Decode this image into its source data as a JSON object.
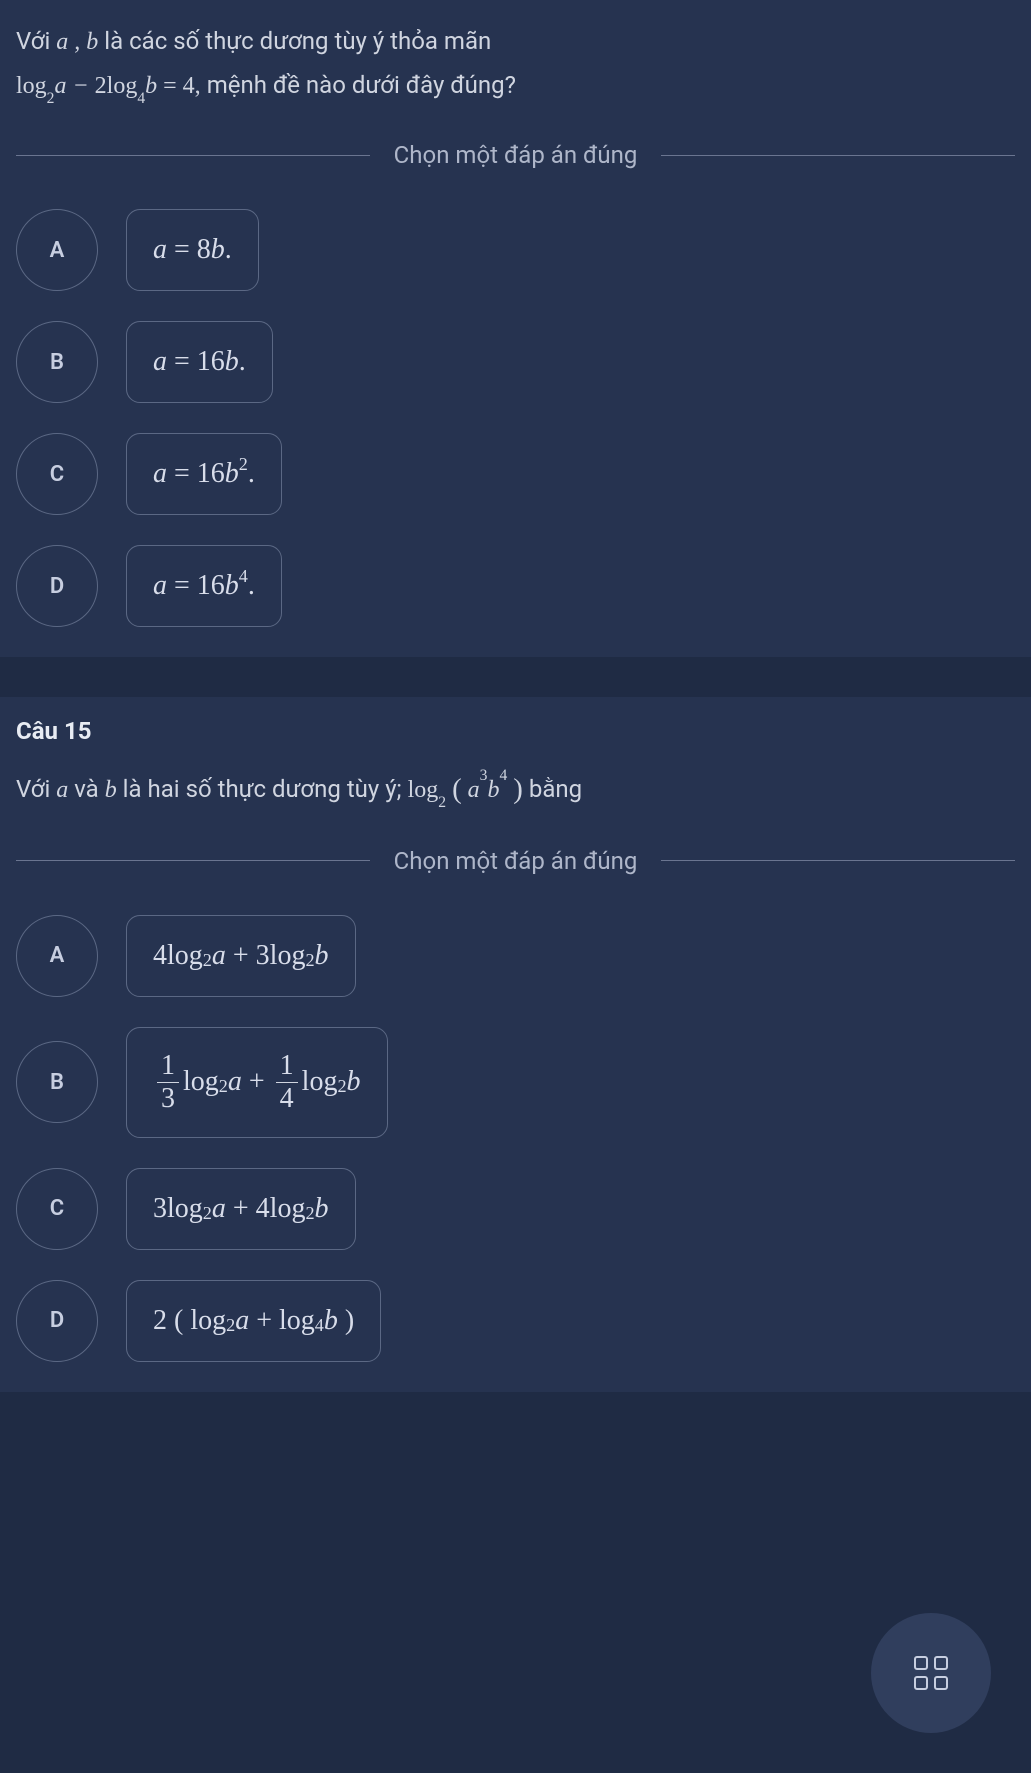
{
  "q14": {
    "stem_line1_pre": "Với ",
    "stem_line1_post": "là các số thực dương tùy ý thỏa mãn",
    "stem_line2_post": " mệnh đề nào dưới đây đúng?",
    "equation_a": "a",
    "equation_comma": " , ",
    "equation_b": "b",
    "divider": "Chọn một đáp án đúng",
    "options": {
      "A": {
        "letter": "A"
      },
      "B": {
        "letter": "B"
      },
      "C": {
        "letter": "C"
      },
      "D": {
        "letter": "D"
      }
    },
    "chart_data": {
      "type": "table",
      "description": "Q14 given and choices (exact math strings)",
      "given": "log_2 a - 2 log_4 b = 4",
      "choices": {
        "A": "a = 8b.",
        "B": "a = 16b.",
        "C": "a = 16b^2.",
        "D": "a = 16b^4."
      }
    }
  },
  "q15": {
    "title": "Câu 15",
    "stem_pre": "Với ",
    "stem_mid1": " và ",
    "stem_mid2": " là hai số thực dương tùy ý; ",
    "stem_post": " bằng",
    "var_a": "a",
    "var_b": "b",
    "divider": "Chọn một đáp án đúng",
    "options": {
      "A": {
        "letter": "A"
      },
      "B": {
        "letter": "B"
      },
      "C": {
        "letter": "C"
      },
      "D": {
        "letter": "D"
      }
    },
    "chart_data": {
      "type": "table",
      "description": "Q15 expression and choices (exact math strings)",
      "expression": "log_2 ( a^3 b^4 )",
      "choices": {
        "A": "4 log_2 a + 3 log_2 b",
        "B": "(1/3) log_2 a + (1/4) log_2 b",
        "C": "3 log_2 a + 4 log_2 b",
        "D": "2 ( log_2 a + log_4 b )"
      }
    }
  }
}
